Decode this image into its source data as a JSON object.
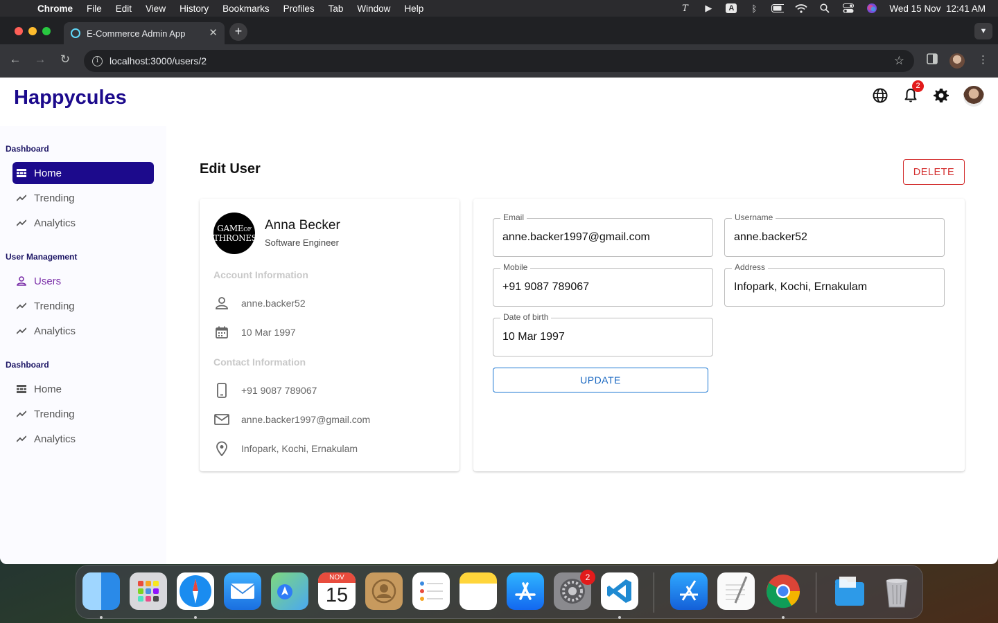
{
  "menubar": {
    "app": "Chrome",
    "items": [
      "File",
      "Edit",
      "View",
      "History",
      "Bookmarks",
      "Profiles",
      "Tab",
      "Window",
      "Help"
    ],
    "datetime": "Wed 15 Nov  12:41 AM"
  },
  "browser": {
    "tab_title": "E-Commerce Admin App",
    "url": "localhost:3000/users/2"
  },
  "app": {
    "logo": "Happycules",
    "notification_count": "2"
  },
  "sidebar": {
    "sections": [
      {
        "title": "Dashboard",
        "items": [
          {
            "label": "Home",
            "icon": "dashboard-icon"
          },
          {
            "label": "Trending",
            "icon": "trending-icon"
          },
          {
            "label": "Analytics",
            "icon": "trending-icon"
          }
        ]
      },
      {
        "title": "User Management",
        "items": [
          {
            "label": "Users",
            "icon": "person-icon"
          },
          {
            "label": "Trending",
            "icon": "trending-icon"
          },
          {
            "label": "Analytics",
            "icon": "trending-icon"
          }
        ]
      },
      {
        "title": "Dashboard",
        "items": [
          {
            "label": "Home",
            "icon": "dashboard-icon"
          },
          {
            "label": "Trending",
            "icon": "trending-icon"
          },
          {
            "label": "Analytics",
            "icon": "trending-icon"
          }
        ]
      }
    ]
  },
  "main": {
    "title": "Edit User",
    "delete_label": "DELETE",
    "profile": {
      "avatar_text": "GAME OF THRONES",
      "name": "Anna Becker",
      "job": "Software Engineer",
      "account_title": "Account Information",
      "username": "anne.backer52",
      "dob": "10 Mar 1997",
      "contact_title": "Contact Information",
      "mobile": "+91 9087 789067",
      "email": "anne.backer1997@gmail.com",
      "address": "Infopark, Kochi, Ernakulam"
    },
    "form": {
      "email_label": "Email",
      "email_value": "anne.backer1997@gmail.com",
      "username_label": "Username",
      "username_value": "anne.backer52",
      "mobile_label": "Mobile",
      "mobile_value": "+91 9087 789067",
      "address_label": "Address",
      "address_value": "Infopark, Kochi, Ernakulam",
      "dob_label": "Date of birth",
      "dob_value": "10 Mar 1997",
      "update_label": "UPDATE"
    }
  },
  "dock": {
    "calendar_month": "NOV",
    "calendar_day": "15",
    "settings_badge": "2"
  },
  "colors": {
    "brand": "#1c0a8c",
    "delete": "#d32f2f",
    "update": "#1976d2",
    "users_active": "#7b2fa8"
  }
}
